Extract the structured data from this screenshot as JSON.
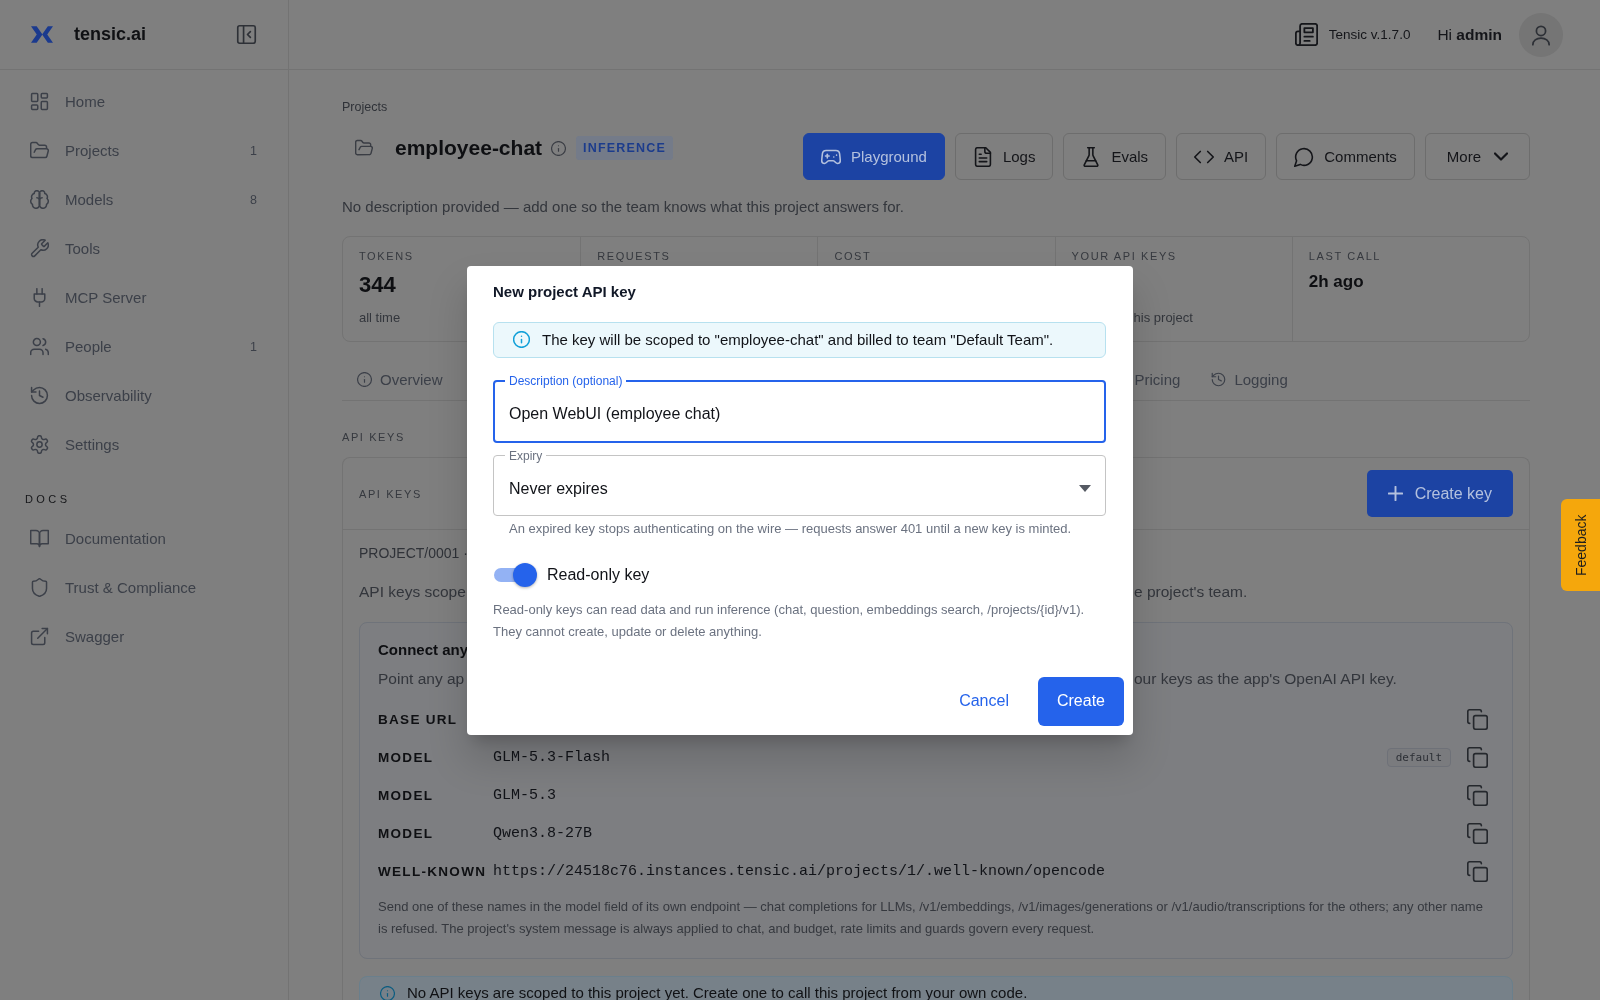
{
  "sidebar": {
    "brand": "tensic.ai",
    "items": [
      {
        "label": "Home",
        "selected": false
      },
      {
        "label": "Projects",
        "count": "1",
        "selected": false
      },
      {
        "label": "Models",
        "count": "8",
        "selected": false
      },
      {
        "label": "Tools",
        "selected": false
      },
      {
        "label": "MCP Server",
        "selected": false
      },
      {
        "label": "People",
        "count": "1",
        "selected": false
      },
      {
        "label": "Observability",
        "selected": false
      },
      {
        "label": "Settings",
        "selected": false
      }
    ],
    "docs_heading": "DOCS",
    "docs_items": [
      {
        "label": "Documentation",
        "selected": false
      },
      {
        "label": "Trust & Compliance",
        "selected": false
      },
      {
        "label": "Swagger",
        "selected": false
      }
    ]
  },
  "header": {
    "version": "Tensic v.1.7.0",
    "greeting": "Hi **admin**"
  },
  "page": {
    "breadcrumb": "Projects",
    "title": "employee-chat",
    "badge": "INFERENCE",
    "actions": [
      {
        "label": "Playground",
        "kind": "primary"
      },
      {
        "label": "Logs",
        "kind": "default"
      },
      {
        "label": "Evals",
        "kind": "default"
      },
      {
        "label": "API",
        "kind": "default"
      },
      {
        "label": "Comments",
        "kind": "default"
      },
      {
        "label": "More",
        "kind": "dropdown"
      }
    ],
    "description": "No description provided — add one so the team knows what this project answers for."
  },
  "stats": [
    {
      "label": "TOKENS",
      "value": "344",
      "sub": "all time"
    },
    {
      "label": "REQUESTS"
    },
    {
      "label": "COST"
    },
    {
      "label": "YOUR API KEYS",
      "sub": "his project"
    },
    {
      "label": "LAST CALL",
      "value": "2h ago"
    }
  ],
  "tabs": [
    {
      "label": "Overview",
      "selected": false
    },
    {
      "label": "Pricing",
      "selected": false
    },
    {
      "label": "Logging",
      "selected": false
    }
  ],
  "api_keys": {
    "section_label": "API KEYS",
    "card_label": "API KEYS",
    "create_button": "Create key",
    "project_ref": "PROJECT/0001 ·",
    "scope_left": "API keys scope",
    "scope_right": "e project's team.",
    "connect": {
      "title": "Connect any",
      "intro_left": "Point any ap",
      "intro_right": "our keys as the app's OpenAI API key.",
      "rows": [
        {
          "label": "BASE URL"
        },
        {
          "label": "MODEL",
          "value": "GLM-5.3-Flash",
          "badge": "default"
        },
        {
          "label": "MODEL",
          "value": "GLM-5.3"
        },
        {
          "label": "MODEL",
          "value": "Qwen3.8-27B"
        },
        {
          "label": "WELL-KNOWN",
          "value": "https://24518c76.instances.tensic.ai/projects/1/.well-known/opencode"
        }
      ],
      "note": "Send one of these names in the model field of its own endpoint — chat completions for LLMs, /v1/embeddings, /v1/images/generations or /v1/audio/transcriptions for the others; any other name is refused. The project's system message is always applied to chat, and budget, rate limits and guards govern every request."
    },
    "empty_notice": "No API keys are scoped to this project yet. Create one to call this project from your own code."
  },
  "modal": {
    "title": "New project API key",
    "notice": "The key will be scoped to \"employee-chat\" and billed to team \"Default Team\".",
    "description_field": {
      "label": "Description (optional)",
      "value": "Open WebUI (employee chat)",
      "focused": true
    },
    "expiry_field": {
      "label": "Expiry",
      "value": "Never expires",
      "focused": false,
      "helper": "An expired key stops authenticating on the wire — requests answer 401 until a new key is minted."
    },
    "read_only": {
      "label": "Read-only key",
      "on": true,
      "help": "Read-only keys can read data and run inference (chat, question, embeddings search, /projects/{id}/v1). They cannot create, update or delete anything."
    },
    "buttons": [
      {
        "label": "Cancel",
        "kind": "text"
      },
      {
        "label": "Create",
        "kind": "primary"
      }
    ]
  },
  "feedback": "Feedback"
}
